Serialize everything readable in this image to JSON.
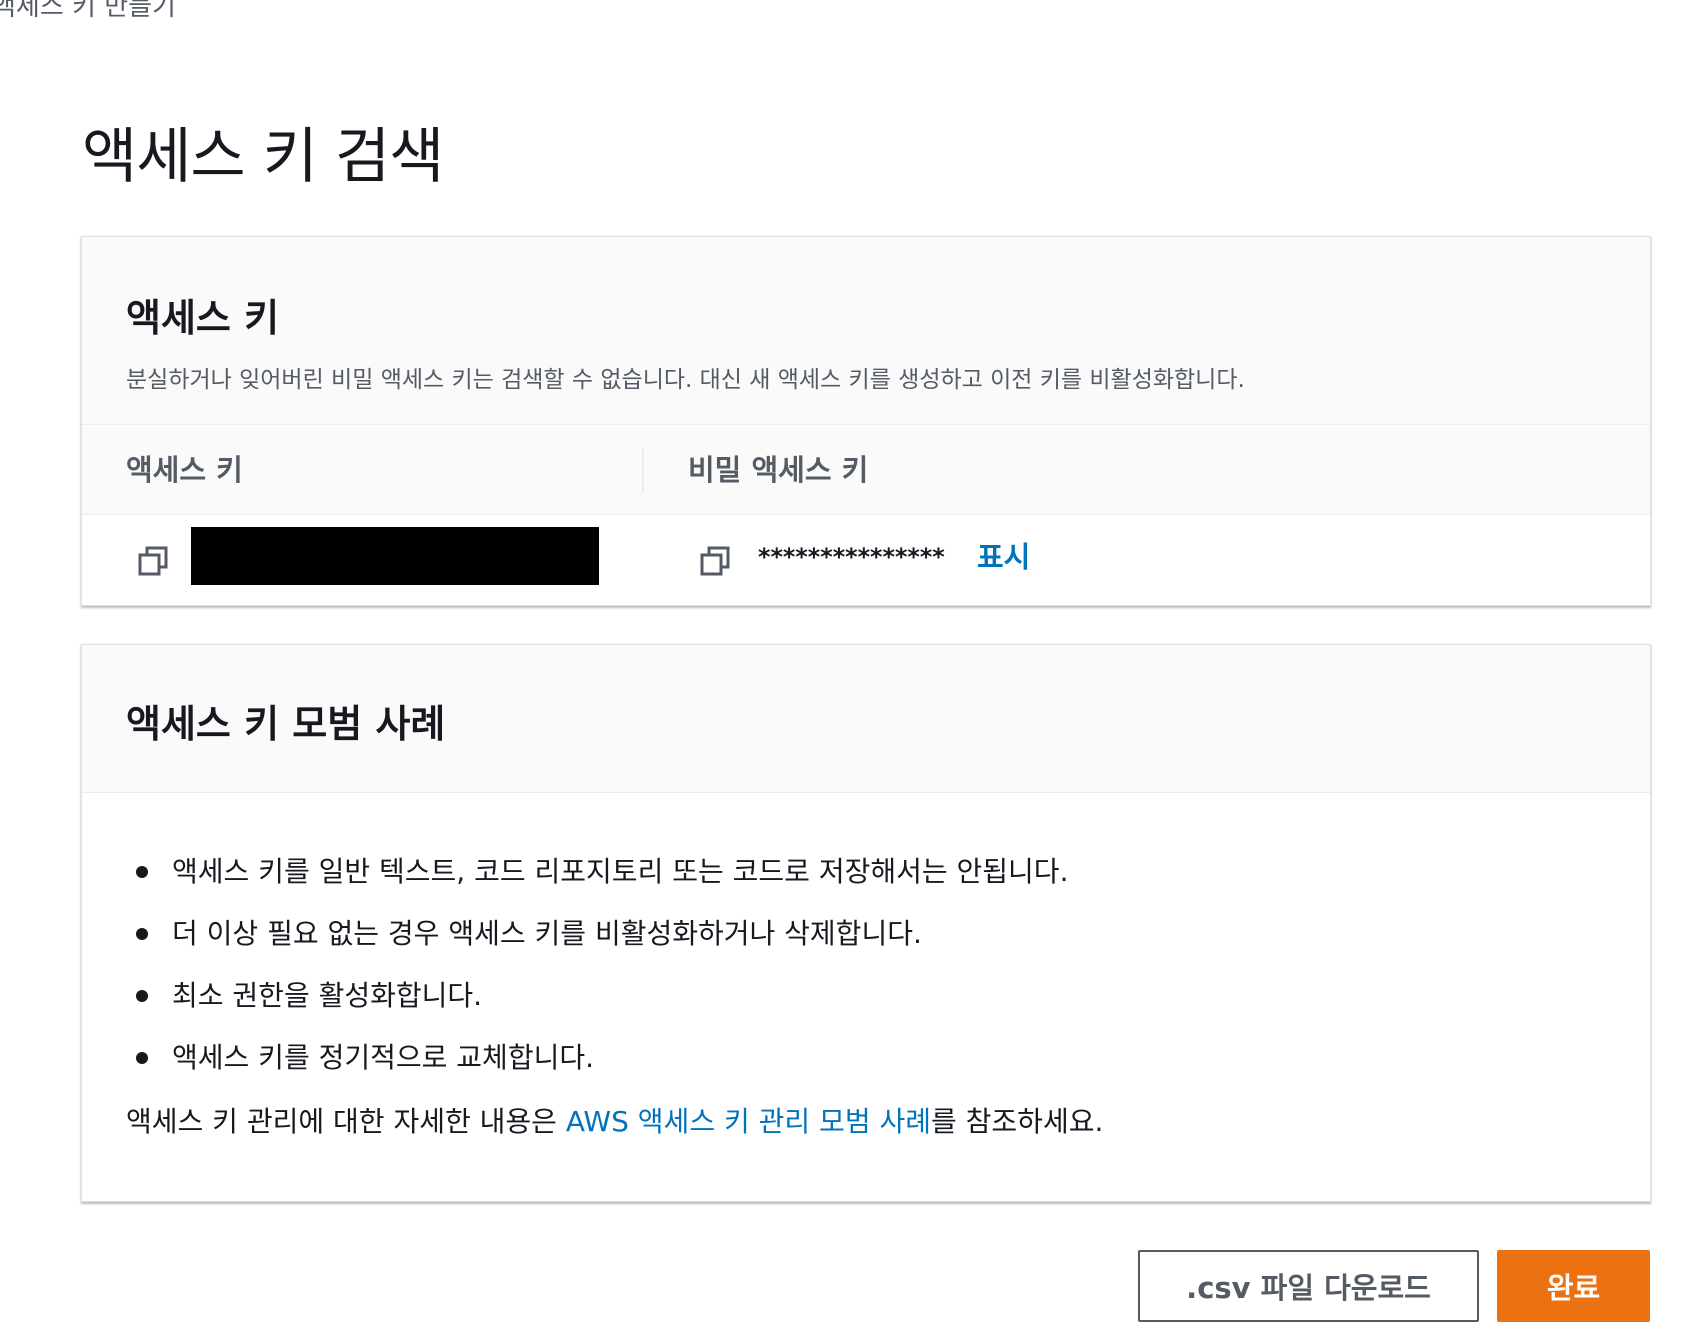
{
  "breadcrumb": {
    "fragment": "액세스 키 만들기"
  },
  "page": {
    "title": "액세스 키 검색"
  },
  "access_keys_panel": {
    "title": "액세스 키",
    "description": "분실하거나 잊어버린 비밀 액세스 키는 검색할 수 없습니다. 대신 새 액세스 키를 생성하고 이전 키를 비활성화합니다.",
    "columns": {
      "access_key": "액세스 키",
      "secret_key": "비밀 액세스 키"
    },
    "row": {
      "secret_masked": "***************",
      "show_label": "표시"
    }
  },
  "best_practices_panel": {
    "title": "액세스 키 모범 사례",
    "items": [
      "액세스 키를 일반 텍스트, 코드 리포지토리 또는 코드로 저장해서는 안됩니다.",
      "더 이상 필요 없는 경우 액세스 키를 비활성화하거나 삭제합니다.",
      "최소 권한을 활성화합니다.",
      "액세스 키를 정기적으로 교체합니다."
    ],
    "footnote": {
      "before": "액세스 키 관리에 대한 자세한 내용은 ",
      "link": "AWS 액세스 키 관리 모범 사례",
      "after": "를 참조하세요."
    }
  },
  "actions": {
    "download_csv": ".csv 파일 다운로드",
    "done": "완료"
  },
  "colors": {
    "primary_button": "#ec7211",
    "link": "#0073bb",
    "text": "#16191f",
    "muted_text": "#545b64"
  },
  "icons": {
    "copy": "copy-icon"
  }
}
